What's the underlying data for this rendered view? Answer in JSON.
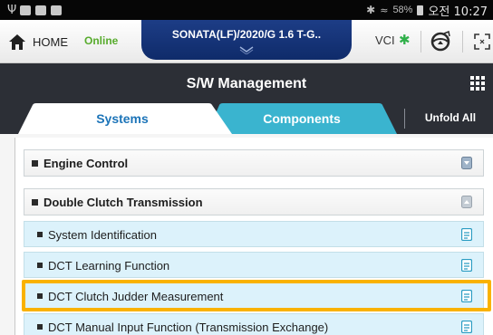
{
  "status_bar": {
    "left_icons": [
      "usb-icon",
      "image-icon",
      "message-icon",
      "calendar-icon"
    ],
    "bluetooth_icon": "bluetooth-icon",
    "signal_icon": "wifi-signal-icon",
    "battery_percent": "58%",
    "time": "오전 10:27"
  },
  "header": {
    "home_label": "HOME",
    "online_status": "Online",
    "vehicle": "SONATA(LF)/2020/G 1.6 T-G..",
    "vci_label": "VCI",
    "colors": {
      "online": "#57ab2c",
      "vehicle_tab": "#1d3d86",
      "bluetooth": "#30b04a"
    }
  },
  "title_bar": {
    "title": "S/W Management"
  },
  "tabs": {
    "items": [
      {
        "label": "Systems",
        "selected": true
      },
      {
        "label": "Components",
        "selected": false
      }
    ],
    "unfold_all": "Unfold All",
    "colors": {
      "systems": "#ffffff",
      "components": "#3ab4cf",
      "accent": "#1c74b8"
    }
  },
  "systems": {
    "groups": [
      {
        "label": "Engine Control",
        "expanded": false,
        "icon": "expand-down-icon"
      },
      {
        "label": "Double Clutch Transmission",
        "expanded": true,
        "icon": "collapse-up-icon",
        "items": [
          {
            "label": "System Identification",
            "icon": "document-icon"
          },
          {
            "label": "DCT Learning Function",
            "icon": "document-icon"
          },
          {
            "label": "DCT Clutch Judder Measurement",
            "icon": "document-icon",
            "highlighted": true
          },
          {
            "label": "DCT Manual Input Function (Transmission Exchange)",
            "icon": "document-icon"
          }
        ]
      }
    ],
    "highlight_color": "#f9b200"
  }
}
